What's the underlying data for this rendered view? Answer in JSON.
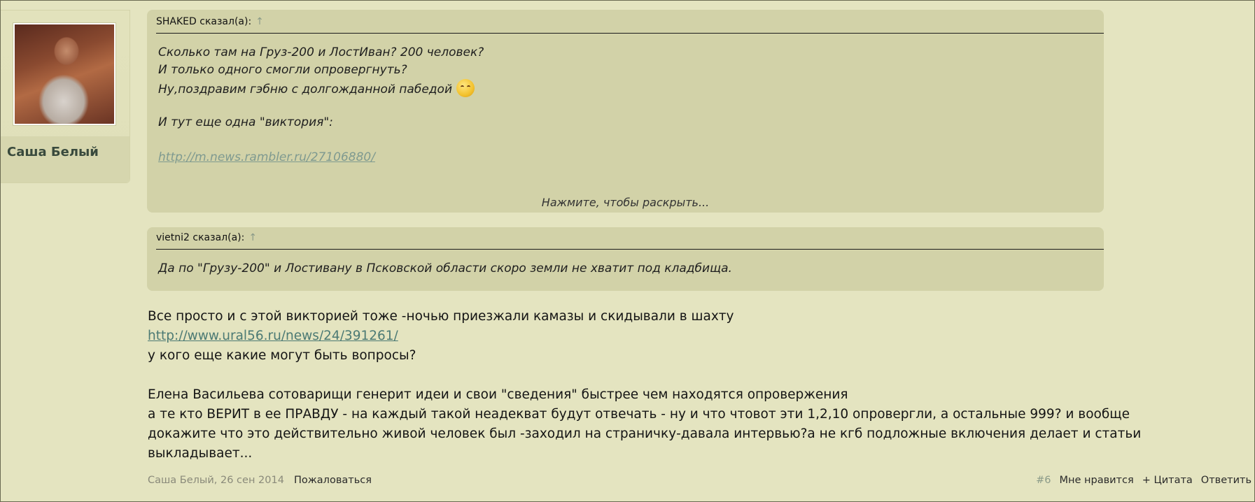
{
  "user": {
    "name": "Саша Белый"
  },
  "quotes": [
    {
      "author": "SHAKED сказал(а):",
      "arrow": "↑",
      "lines": [
        "Сколько там на Груз-200 и ЛостИван? 200 человек?",
        "И только одного смогли опровергнуть?",
        "Ну,поздравим гэбню с долгожданной пабедой",
        "",
        "И тут еще одна \"виктория\":",
        "",
        "http://m.news.rambler.ru/27106880/"
      ],
      "emoji_icon": "smirk-emoji-icon",
      "expand_label": "Нажмите, чтобы раскрыть..."
    },
    {
      "author": "vietni2 сказал(а):",
      "arrow": "↑",
      "lines": [
        "Да по \"Грузу-200\" и Лостивану в Псковской области скоро земли не хватит под кладбища."
      ]
    }
  ],
  "message": {
    "lines": [
      "Все просто и с этой викторией тоже -ночью приезжали камазы и скидывали в шахту",
      "http://www.ural56.ru/news/24/391261/",
      "у кого еще какие могут быть вопросы?",
      "",
      "Елена Васильева сотоварищи генерит идеи и свои \"сведения\" быстрее чем находятся опровержения",
      "а те кто ВЕРИТ в ее ПРАВДУ - на каждый такой неадекват будут отвечать - ну и что чтовот эти 1,2,10 опровергли, а остальные 999? и вообще",
      "докажите что это действительно живой человек был -заходил на страничку-давала интервью?а не кгб подложные включения делает и статьи",
      "выкладывает..."
    ]
  },
  "footer": {
    "author_date": "Саша Белый, 26 сен 2014",
    "report": "Пожаловаться",
    "post_number": "#6",
    "like": "Мне нравится",
    "quote": "+ Цитата",
    "reply": "Ответить"
  },
  "colors": {
    "background": "#e4e4c0",
    "quote_background": "#d2d2a8",
    "link": "#4c7a74",
    "faded_link": "#7f9a90"
  }
}
